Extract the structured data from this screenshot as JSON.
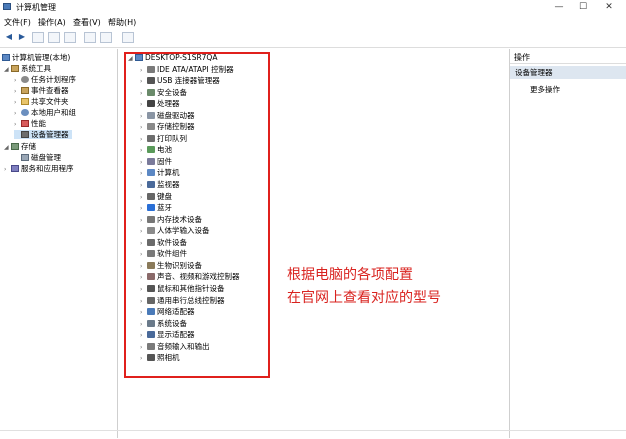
{
  "window": {
    "title": "计算机管理",
    "minimize": "—",
    "maximize": "☐",
    "close": "✕"
  },
  "menu": [
    "文件(F)",
    "操作(A)",
    "查看(V)",
    "帮助(H)"
  ],
  "toolbar": {
    "back": "◀",
    "forward": "▶"
  },
  "left_tree": {
    "root": "计算机管理(本地)",
    "system_tools": "系统工具",
    "items": [
      "任务计划程序",
      "事件查看器",
      "共享文件夹",
      "本地用户和组",
      "性能",
      "设备管理器"
    ],
    "storage": "存储",
    "disk_mgmt": "磁盘管理",
    "services": "服务和应用程序"
  },
  "device_tree": {
    "root": "DESKTOP-S1SR7QA",
    "devices": [
      "IDE ATA/ATAPI 控制器",
      "USB 连接器管理器",
      "安全设备",
      "处理器",
      "磁盘驱动器",
      "存储控制器",
      "打印队列",
      "电池",
      "固件",
      "计算机",
      "监视器",
      "键盘",
      "蓝牙",
      "内存技术设备",
      "人体学输入设备",
      "软件设备",
      "软件组件",
      "生物识别设备",
      "声音、视频和游戏控制器",
      "鼠标和其他指针设备",
      "通用串行总线控制器",
      "网络适配器",
      "系统设备",
      "显示适配器",
      "音频输入和输出",
      "照相机"
    ]
  },
  "annotation": {
    "line1": "根据电脑的各项配置",
    "line2": "在官网上查看对应的型号"
  },
  "actions": {
    "header": "操作",
    "section": "设备管理器",
    "more": "更多操作"
  },
  "colors": {
    "annotation": "#d9231f",
    "highlight_box": "#e0201c",
    "selection": "#cde3f7"
  }
}
